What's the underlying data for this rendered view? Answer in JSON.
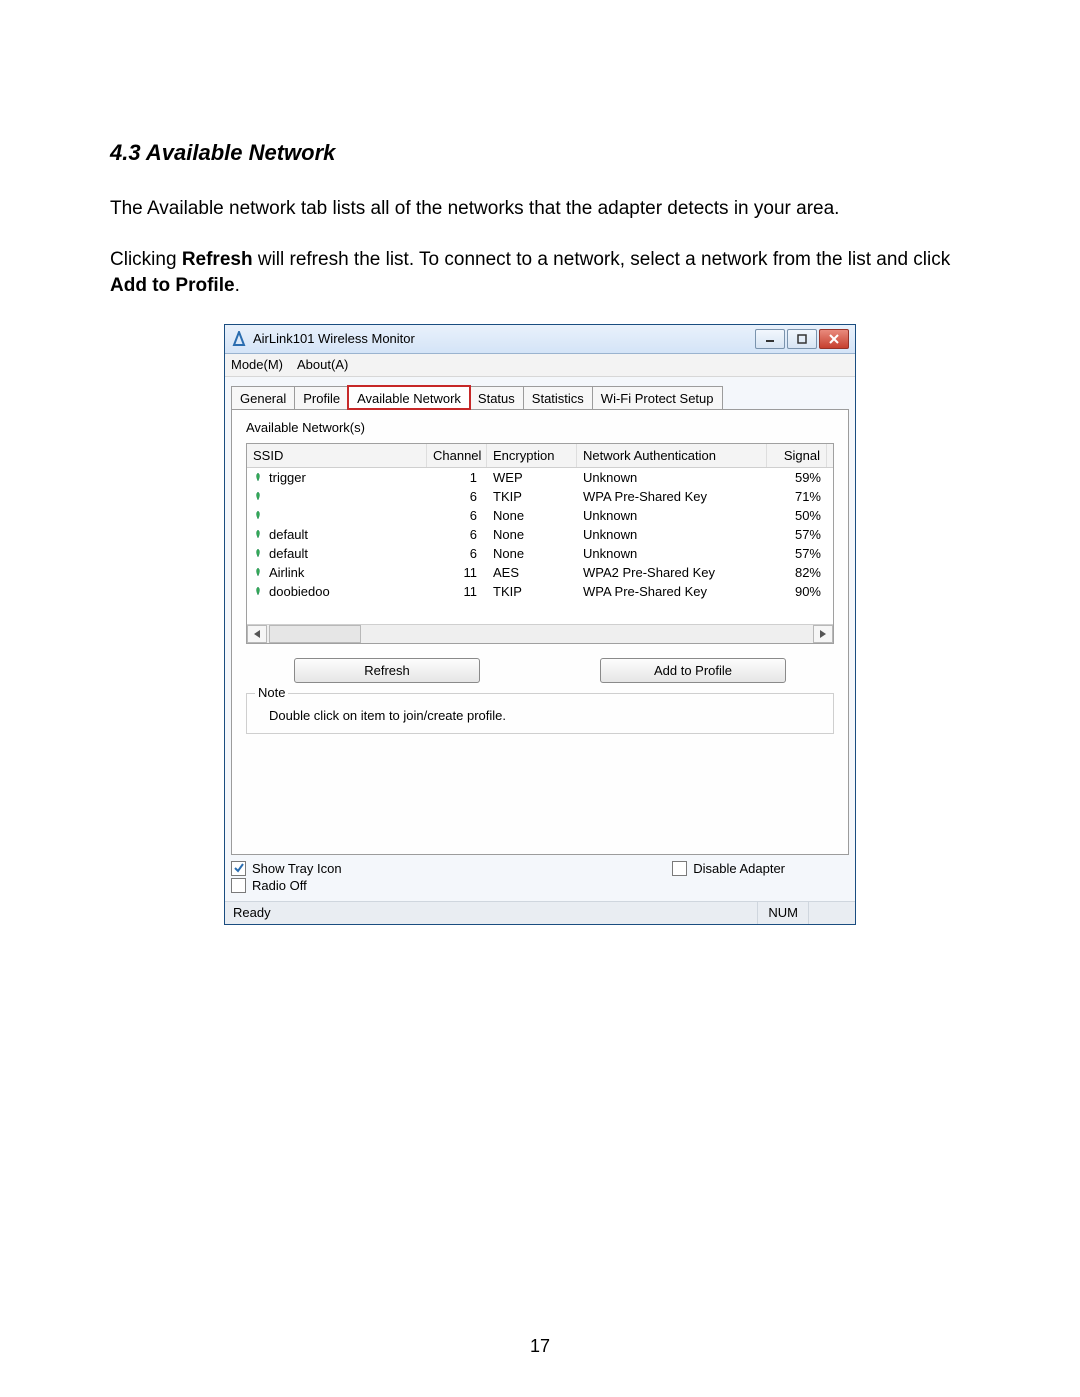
{
  "doc": {
    "heading": "4.3 Available Network",
    "para1": "The Available network tab lists all of the networks that the adapter detects in your area.",
    "para2a": "Clicking ",
    "para2b": "Refresh",
    "para2c": " will refresh the list.  To connect to a network, select a network from the list and click ",
    "para2d": "Add to Profile",
    "para2e": ".",
    "page_number": "17"
  },
  "window": {
    "title": "AirLink101 Wireless Monitor",
    "menu": {
      "mode": "Mode(M)",
      "about": "About(A)"
    },
    "tabs": {
      "general": "General",
      "profile": "Profile",
      "available_network": "Available Network",
      "status": "Status",
      "statistics": "Statistics",
      "wps": "Wi-Fi Protect Setup"
    },
    "group_label": "Available Network(s)",
    "columns": {
      "ssid": "SSID",
      "channel": "Channel",
      "encryption": "Encryption",
      "auth": "Network Authentication",
      "signal": "Signal"
    },
    "rows": [
      {
        "ssid": "trigger",
        "channel": "1",
        "enc": "WEP",
        "auth": "Unknown",
        "signal": "59%"
      },
      {
        "ssid": "",
        "channel": "6",
        "enc": "TKIP",
        "auth": "WPA Pre-Shared Key",
        "signal": "71%"
      },
      {
        "ssid": "",
        "channel": "6",
        "enc": "None",
        "auth": "Unknown",
        "signal": "50%"
      },
      {
        "ssid": "default",
        "channel": "6",
        "enc": "None",
        "auth": "Unknown",
        "signal": "57%"
      },
      {
        "ssid": "default",
        "channel": "6",
        "enc": "None",
        "auth": "Unknown",
        "signal": "57%"
      },
      {
        "ssid": "Airlink",
        "channel": "11",
        "enc": "AES",
        "auth": "WPA2 Pre-Shared Key",
        "signal": "82%"
      },
      {
        "ssid": "doobiedoo",
        "channel": "11",
        "enc": "TKIP",
        "auth": "WPA Pre-Shared Key",
        "signal": "90%"
      }
    ],
    "buttons": {
      "refresh": "Refresh",
      "add_to_profile": "Add to Profile"
    },
    "note": {
      "label": "Note",
      "body": "Double click on item to join/create profile."
    },
    "checks": {
      "show_tray": {
        "label": "Show Tray Icon",
        "checked": true
      },
      "disable_adapter": {
        "label": "Disable Adapter",
        "checked": false
      },
      "radio_off": {
        "label": "Radio Off",
        "checked": false
      }
    },
    "status": {
      "ready": "Ready",
      "num": "NUM"
    }
  }
}
